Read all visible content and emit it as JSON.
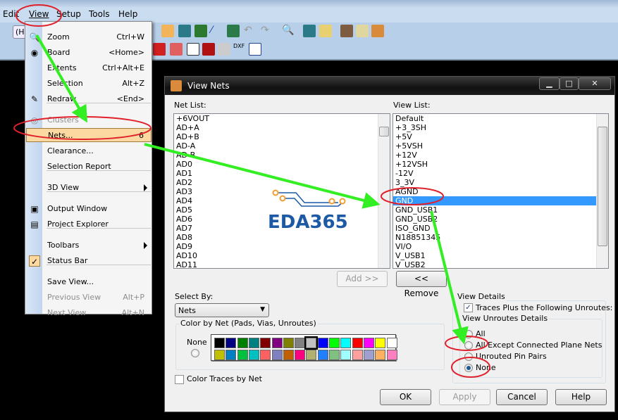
{
  "menubar": {
    "items": [
      "Edit",
      "View",
      "Setup",
      "Tools",
      "Help"
    ]
  },
  "view_menu": {
    "items": [
      {
        "label": "Zoom",
        "shortcut": "Ctrl+W",
        "icon": "zoom-icon"
      },
      {
        "label": "Board",
        "shortcut": "<Home>",
        "icon": "board-icon"
      },
      {
        "label": "Extents",
        "shortcut": "Ctrl+Alt+E"
      },
      {
        "label": "Selection",
        "shortcut": "Alt+Z"
      },
      {
        "label": "Redraw",
        "shortcut": "<End>",
        "icon": "brush-icon"
      },
      {
        "label": "Clusters",
        "shortcut": "",
        "disabled": true,
        "icon": "clusters-icon"
      },
      {
        "label": "Nets...",
        "shortcut": "6",
        "highlighted": true
      },
      {
        "label": "Clearance...",
        "shortcut": ""
      },
      {
        "label": "Selection Report",
        "shortcut": ""
      },
      {
        "label": "3D View",
        "shortcut": "",
        "submenu": true
      },
      {
        "label": "Output Window",
        "shortcut": "",
        "icon": "output-window-icon"
      },
      {
        "label": "Project Explorer",
        "shortcut": "",
        "icon": "project-explorer-icon"
      },
      {
        "label": "Toolbars",
        "shortcut": "",
        "submenu": true
      },
      {
        "label": "Status Bar",
        "shortcut": "",
        "checked": true
      },
      {
        "label": "Save View...",
        "shortcut": ""
      },
      {
        "label": "Previous View",
        "shortcut": "Alt+P",
        "disabled": true
      },
      {
        "label": "Next View",
        "shortcut": "Alt+N",
        "disabled": true
      }
    ]
  },
  "toolbar": {
    "partial_label": "(H"
  },
  "dialog": {
    "title": "View Nets",
    "net_list_label": "Net List:",
    "net_list": [
      "+6VOUT",
      "AD+A",
      "AD+B",
      "AD-A",
      "AD-B",
      "AD0",
      "AD1",
      "AD2",
      "AD3",
      "AD4",
      "AD5",
      "AD6",
      "AD7",
      "AD8",
      "AD9",
      "AD10",
      "AD11"
    ],
    "view_list_label": "View List:",
    "view_list": [
      "Default",
      "+3_3SH",
      "+5V",
      "+5VSH",
      "+12V",
      "+12VSH",
      "-12V",
      "3_3V",
      "AGND",
      "GND",
      "GND_USB1",
      "GND_USB2",
      "ISO_GND",
      "N18851345",
      "VI/O",
      "V_USB1",
      "V_USB2"
    ],
    "view_list_selected": "GND",
    "add_button": "Add >>",
    "remove_button": "<< Remove",
    "select_by_label": "Select By:",
    "select_by_value": "Nets",
    "color_group_label": "Color by Net (Pads, Vias, Unroutes)",
    "none_label": "None",
    "palette_row1": [
      "#000000",
      "#000080",
      "#008000",
      "#008080",
      "#800000",
      "#800080",
      "#808000",
      "#808080",
      "#c0c0c0",
      "#0000ff",
      "#00ff00",
      "#00ffff",
      "#ff0000",
      "#ff00ff",
      "#ffff00",
      "#ffffff"
    ],
    "palette_row2": [
      "#c0c000",
      "#0080c0",
      "#00c040",
      "#00c0c0",
      "#ff6060",
      "#8080c0",
      "#c06000",
      "#ff0080",
      "#b0b070",
      "#2080ff",
      "#80c080",
      "#a0ffff",
      "#ffa0a0",
      "#a0a0d0",
      "#ffb060",
      "#ff80c0"
    ],
    "color_traces_label": "Color Traces by Net",
    "view_details_label": "View Details",
    "traces_plus_label": "Traces Plus the Following Unroutes:",
    "unroutes_group_label": "View Unroutes Details",
    "unroute_options": [
      "All",
      "All Except Connected Plane Nets",
      "Unrouted Pin Pairs",
      "None"
    ],
    "unroute_selected": "None",
    "buttons": {
      "ok": "OK",
      "apply": "Apply",
      "cancel": "Cancel",
      "help": "Help"
    }
  },
  "watermark": {
    "text": "EDA365"
  },
  "colors": {
    "annotation_red": "#e0202a",
    "annotation_green": "#33ee22",
    "selection": "#3399ff"
  }
}
